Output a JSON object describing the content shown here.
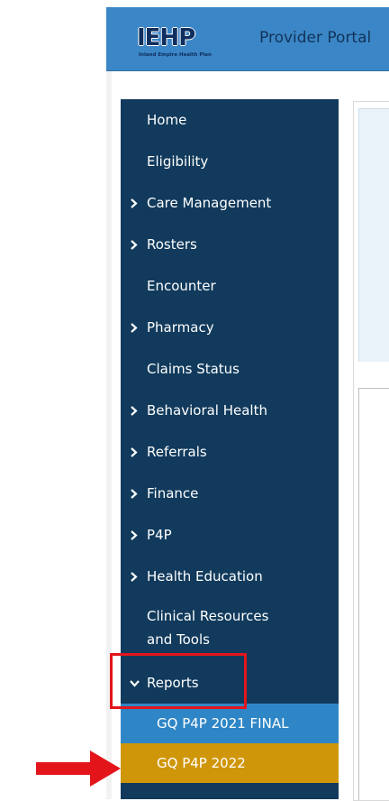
{
  "header": {
    "logo_text": "IEHP",
    "logo_sub": "Inland Empire Health Plan",
    "title": "Provider Portal"
  },
  "sidebar": {
    "items": [
      {
        "label": "Home",
        "expandable": false
      },
      {
        "label": "Eligibility",
        "expandable": false
      },
      {
        "label": "Care Management",
        "expandable": true
      },
      {
        "label": "Rosters",
        "expandable": true
      },
      {
        "label": "Encounter",
        "expandable": false
      },
      {
        "label": "Pharmacy",
        "expandable": true
      },
      {
        "label": "Claims Status",
        "expandable": false
      },
      {
        "label": "Behavioral Health",
        "expandable": true
      },
      {
        "label": "Referrals",
        "expandable": true
      },
      {
        "label": "Finance",
        "expandable": true
      },
      {
        "label": "P4P",
        "expandable": true
      },
      {
        "label": "Health Education",
        "expandable": true
      },
      {
        "label_line1": "Clinical Resources",
        "label_line2": "and Tools",
        "expandable": false
      },
      {
        "label": "Reports",
        "expandable": true,
        "expanded": true
      }
    ],
    "reports_submenu": [
      {
        "label": "GQ P4P 2021 FINAL",
        "color": "#2f86c6"
      },
      {
        "label": "GQ P4P 2022",
        "color": "#d0960a"
      }
    ]
  },
  "colors": {
    "header_bg": "#3b86c6",
    "sidebar_bg": "#113a5c",
    "annotation_red": "#e3151b"
  }
}
